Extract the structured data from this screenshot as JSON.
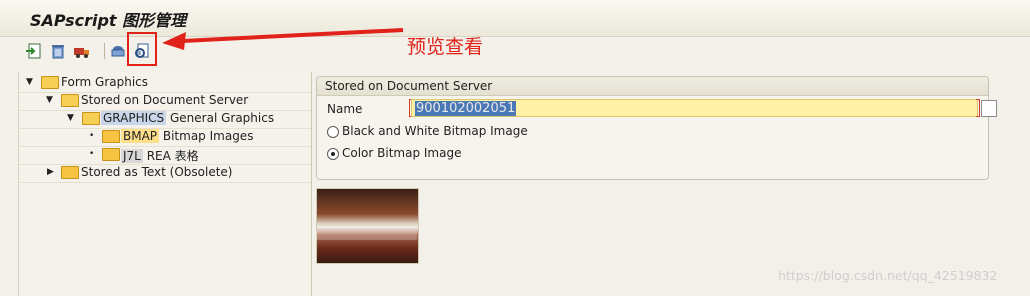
{
  "window": {
    "title": "SAPscript 图形管理"
  },
  "annotation": {
    "text": "预览查看"
  },
  "toolbar": {
    "buttons": [
      {
        "icon": "import-icon"
      },
      {
        "icon": "delete-icon"
      },
      {
        "icon": "transport-icon"
      },
      {
        "icon": "print-icon"
      },
      {
        "icon": "print-preview-icon"
      }
    ]
  },
  "tree": {
    "root": "Form Graphics",
    "doc_server": "Stored on Document Server",
    "graphics_code": "GRAPHICS",
    "graphics_label": "General Graphics",
    "bmap_code": "BMAP",
    "bmap_label": "Bitmap Images",
    "j7l_code": "J7L",
    "j7l_label": "REA 表格",
    "stored_text": "Stored as Text (Obsolete)"
  },
  "form": {
    "group_title": "Stored on Document Server",
    "name_label": "Name",
    "name_value": "900102002051",
    "radio_bw": "Black and White Bitmap Image",
    "radio_color": "Color Bitmap Image",
    "selected": "color"
  },
  "watermark": "https://blog.csdn.net/qq_42519832"
}
